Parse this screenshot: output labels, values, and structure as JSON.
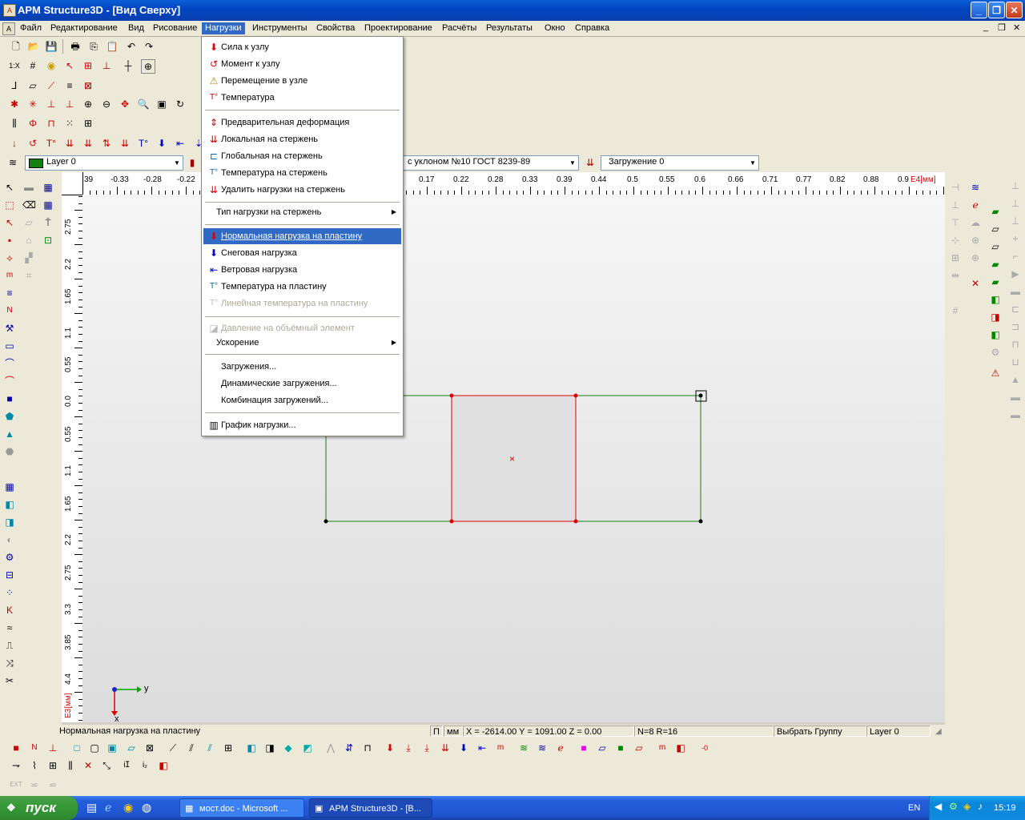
{
  "window": {
    "title": "APM Structure3D - [Вид Сверху]"
  },
  "menu": [
    "Файл",
    "Редактирование",
    "Вид",
    "Рисование",
    "Нагрузки",
    "Инструменты",
    "Свойства",
    "Проектирование",
    "Расчёты",
    "Результаты",
    "Окно",
    "Справка"
  ],
  "menu_active": "Нагрузки",
  "dropdown": {
    "items": [
      {
        "label": "Сила к узлу",
        "icon": "force-node-icon"
      },
      {
        "label": "Момент к узлу",
        "icon": "moment-node-icon"
      },
      {
        "label": "Перемещение в узле",
        "icon": "displacement-node-icon"
      },
      {
        "label": "Температура",
        "icon": "temperature-icon"
      },
      {
        "label": "Предварительная деформация",
        "icon": "predeformation-icon"
      },
      {
        "label": "Локальная на стержень",
        "icon": "local-bar-load-icon"
      },
      {
        "label": "Глобальная на стержень",
        "icon": "global-bar-load-icon"
      },
      {
        "label": "Температура на стержень",
        "icon": "bar-temperature-icon"
      },
      {
        "label": "Удалить нагрузки на стержень",
        "icon": "delete-bar-load-icon"
      },
      {
        "label": "Тип нагрузки на стержень"
      },
      {
        "label": "Нормальная нагрузка на пластину",
        "icon": "plate-normal-load-icon"
      },
      {
        "label": "Снеговая нагрузка",
        "icon": "snow-load-icon"
      },
      {
        "label": "Ветровая нагрузка",
        "icon": "wind-load-icon"
      },
      {
        "label": "Температура на пластину",
        "icon": "plate-temperature-icon"
      },
      {
        "label": "Линейная температура на пластину",
        "icon": "plate-linear-temp-icon"
      },
      {
        "label": "Давление на объёмный элемент",
        "icon": "volume-pressure-icon"
      },
      {
        "label": "Ускорение"
      },
      {
        "label": "Загружения..."
      },
      {
        "label": "Динамические загружения..."
      },
      {
        "label": "Комбинация загружений..."
      },
      {
        "label": "График нагрузки...",
        "icon": "load-chart-icon"
      }
    ]
  },
  "layer_select": "Layer 0",
  "profile_select": "с уклоном  №10 ГОСТ 8239-89",
  "loadcase_select": "Загружение 0",
  "hruler": {
    "labels": [
      "39",
      "-0.33",
      "-0.28",
      "-0.22",
      "0.17",
      "0.22",
      "0.28",
      "0.33",
      "0.39",
      "0.44",
      "0.5",
      "0.55",
      "0.6",
      "0.66",
      "0.71",
      "0.77",
      "0.82",
      "0.88",
      "0.9"
    ],
    "unit": "E4[мм]"
  },
  "vruler": {
    "labels": [
      "2.75",
      "2.2",
      "1.65",
      "1.1",
      "0.55",
      "0.0",
      "0.55",
      "1.1",
      "1.65",
      "2.2",
      "2.75",
      "3.3",
      "3.85",
      "4.4"
    ],
    "unit": "E3[мм]"
  },
  "axes": {
    "y": "y",
    "x": "x"
  },
  "status": {
    "hint": "Нормальная нагрузка на пластину",
    "mode": "П",
    "unit": "мм",
    "coords": "X = -2614.00 Y = 1091.00 Z = 0.00",
    "counts": "N=8 R=16",
    "action": "Выбрать Группу",
    "layer": "Layer 0"
  },
  "taskbar": {
    "start": "пуск",
    "buttons": [
      "мост.doc - Microsoft ...",
      "APM Structure3D - [В..."
    ],
    "lang": "EN",
    "time": "15:19"
  }
}
